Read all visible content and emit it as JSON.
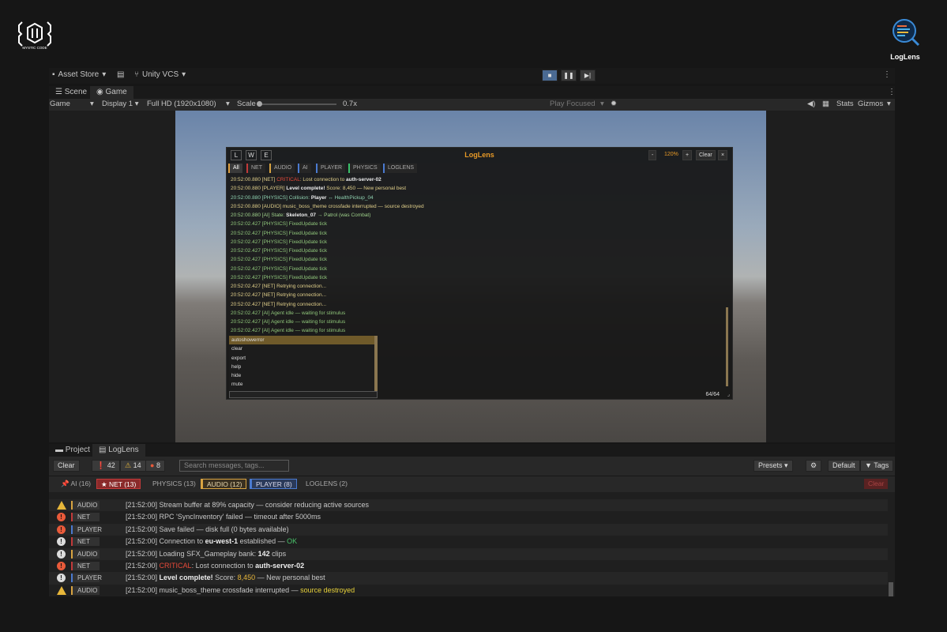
{
  "logos": {
    "mystic": "MYSTIC CODE",
    "loglens": "LogLens"
  },
  "top_bar": {
    "asset_store": "Asset Store",
    "vcs": "Unity VCS"
  },
  "view_tabs": [
    "Scene",
    "Game"
  ],
  "game_toolbar": {
    "mode": "Game",
    "display": "Display 1",
    "resolution": "Full HD (1920x1080)",
    "scale_label": "Scale",
    "scale_value": "0.7x",
    "play_focused": "Play Focused",
    "stats": "Stats",
    "gizmos": "Gizmos"
  },
  "overlay": {
    "title": "LogLens",
    "lwe": [
      "L",
      "W",
      "E"
    ],
    "zoom": "120%",
    "minus": "-",
    "plus": "+",
    "clear": "Clear",
    "close": "×",
    "tabs": [
      "All",
      "NET",
      "AUDIO",
      "AI",
      "PLAYER",
      "PHYSICS",
      "LOGLENS"
    ],
    "lines": [
      {
        "pre": "20:52:00.880 [NET] ",
        "hl": "CRITICAL",
        "mid": ": Lost connection to ",
        "b": "auth-server-02",
        "post": "",
        "color": "#e0cf8a"
      },
      {
        "pre": "20:52:00.880 [PLAYER] ",
        "hl": "",
        "mid": "",
        "b": "Level complete!",
        "post": " Score: 8,450 — New personal best",
        "color": "#e0cf8a"
      },
      {
        "pre": "20:52:00.880 [PHYSICS] Collision: ",
        "hl": "",
        "mid": "",
        "b": "Player",
        "post": " ↔ HealthPickup_04",
        "color": "#8fd0b0"
      },
      {
        "pre": "20:52:00.880 [AUDIO] music_boss_theme crossfade interrupted — ",
        "hl": "",
        "mid": "",
        "b": "",
        "post": "source destroyed",
        "color": "#e0cf8a"
      },
      {
        "pre": "20:52:00.880 [AI] State: ",
        "hl": "",
        "mid": "",
        "b": "Skeleton_07",
        "post": " → Patrol (was Combat)",
        "color": "#9ed08a"
      },
      {
        "pre": "20:52:02.427 [PHYSICS] FixedUpdate tick",
        "hl": "",
        "mid": "",
        "b": "",
        "post": "",
        "color": "#8fc57a"
      },
      {
        "pre": "20:52:02.427 [PHYSICS] FixedUpdate tick",
        "hl": "",
        "mid": "",
        "b": "",
        "post": "",
        "color": "#8fc57a"
      },
      {
        "pre": "20:52:02.427 [PHYSICS] FixedUpdate tick",
        "hl": "",
        "mid": "",
        "b": "",
        "post": "",
        "color": "#8fc57a"
      },
      {
        "pre": "20:52:02.427 [PHYSICS] FixedUpdate tick",
        "hl": "",
        "mid": "",
        "b": "",
        "post": "",
        "color": "#8fc57a"
      },
      {
        "pre": "20:52:02.427 [PHYSICS] FixedUpdate tick",
        "hl": "",
        "mid": "",
        "b": "",
        "post": "",
        "color": "#8fc57a"
      },
      {
        "pre": "20:52:02.427 [PHYSICS] FixedUpdate tick",
        "hl": "",
        "mid": "",
        "b": "",
        "post": "",
        "color": "#8fc57a"
      },
      {
        "pre": "20:52:02.427 [PHYSICS] FixedUpdate tick",
        "hl": "",
        "mid": "",
        "b": "",
        "post": "",
        "color": "#8fc57a"
      },
      {
        "pre": "20:52:02.427 [NET] Retrying connection...",
        "hl": "",
        "mid": "",
        "b": "",
        "post": "",
        "color": "#e0cf8a"
      },
      {
        "pre": "20:52:02.427 [NET] Retrying connection...",
        "hl": "",
        "mid": "",
        "b": "",
        "post": "",
        "color": "#e0cf8a"
      },
      {
        "pre": "20:52:02.427 [NET] Retrying connection...",
        "hl": "",
        "mid": "",
        "b": "",
        "post": "",
        "color": "#e0cf8a"
      },
      {
        "pre": "20:52:02.427 [AI] Agent idle — waiting for stimulus",
        "hl": "",
        "mid": "",
        "b": "",
        "post": "",
        "color": "#8fc57a"
      },
      {
        "pre": "20:52:02.427 [AI] Agent idle — waiting for stimulus",
        "hl": "",
        "mid": "",
        "b": "",
        "post": "",
        "color": "#8fc57a"
      },
      {
        "pre": "20:52:02.427 [AI] Agent idle — waiting for stimulus",
        "hl": "",
        "mid": "",
        "b": "",
        "post": "",
        "color": "#8fc57a"
      }
    ],
    "dropdown": [
      "autoshowerror",
      "clear",
      "export",
      "help",
      "hide",
      "mute"
    ],
    "count": "64/64"
  },
  "bottom_tabs": [
    "Project",
    "LogLens"
  ],
  "bottom_toolbar": {
    "clear": "Clear",
    "info_count": "42",
    "warn_count": "14",
    "error_count": "8",
    "search_placeholder": "Search messages, tags...",
    "presets": "Presets",
    "default": "Default",
    "tags": "Tags"
  },
  "category_tabs": [
    {
      "label": "AI (16)",
      "color": "#b0384a",
      "active": false
    },
    {
      "label": "★ NET (13)",
      "color": "#c23a3a",
      "active": true
    },
    {
      "label": "PHYSICS (13)",
      "color": "#6a6a6a",
      "active": false
    },
    {
      "label": "AUDIO (12)",
      "color": "#d9a441",
      "active": true
    },
    {
      "label": "PLAYER (8)",
      "color": "#4a7ad0",
      "active": true
    },
    {
      "label": "LOGLENS (2)",
      "color": "#6a6a6a",
      "active": false
    }
  ],
  "category_clear": "Clear",
  "log_rows": [
    {
      "icon": "warn",
      "tag": "AUDIO",
      "tag_color": "#d9a441",
      "pre": "[21:52:00] Stream buffer at 89% capacity — consider reducing active sources",
      "hl": "",
      "b": "",
      "post": "",
      "hl_color": ""
    },
    {
      "icon": "error",
      "tag": "NET",
      "tag_color": "#c23a3a",
      "pre": "[21:52:00] RPC 'SyncInventory' failed — timeout after 5000ms",
      "hl": "",
      "b": "",
      "post": "",
      "hl_color": ""
    },
    {
      "icon": "error",
      "tag": "PLAYER",
      "tag_color": "#4a7ad0",
      "pre": "[21:52:00] Save failed — disk full (0 bytes available)",
      "hl": "",
      "b": "",
      "post": "",
      "hl_color": ""
    },
    {
      "icon": "info",
      "tag": "NET",
      "tag_color": "#c23a3a",
      "pre": "[21:52:00] Connection to ",
      "b": "eu-west-1",
      "hl": "",
      "post": " established — ",
      "tail": "OK",
      "tail_color": "#4ac26a"
    },
    {
      "icon": "info",
      "tag": "AUDIO",
      "tag_color": "#d9a441",
      "pre": "[21:52:00] Loading SFX_Gameplay bank: ",
      "b": "142",
      "hl": "",
      "post": " clips",
      "tail": "",
      "tail_color": ""
    },
    {
      "icon": "error",
      "tag": "NET",
      "tag_color": "#c23a3a",
      "pre": "[21:52:00] ",
      "hl": "CRITICAL",
      "b": "auth-server-02",
      "post": ": Lost connection to ",
      "tail": "",
      "tail_color": ""
    },
    {
      "icon": "info",
      "tag": "PLAYER",
      "tag_color": "#4a7ad0",
      "pre": "[21:52:00] ",
      "b": "Level complete!",
      "hl": "",
      "post": " Score: ",
      "tail": "8,450",
      "tail_color": "#e8b73a",
      "after": " — New personal best"
    },
    {
      "icon": "warn",
      "tag": "AUDIO",
      "tag_color": "#d9a441",
      "pre": "[21:52:00] music_boss_theme crossfade interrupted — ",
      "b": "",
      "hl": "",
      "post": "",
      "tail": "source destroyed",
      "tail_color": "#e8d23a"
    }
  ]
}
